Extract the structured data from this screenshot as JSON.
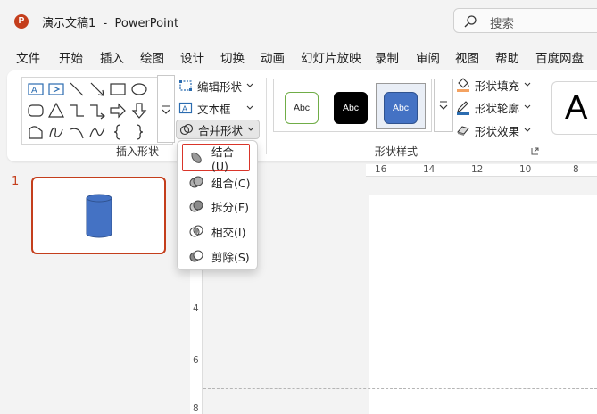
{
  "window": {
    "title": "演示文稿1  -  PowerPoint",
    "app_icon_letter": "P"
  },
  "search": {
    "placeholder": "搜索"
  },
  "menu": [
    "文件",
    "开始",
    "插入",
    "绘图",
    "设计",
    "切换",
    "动画",
    "幻灯片放映",
    "录制",
    "审阅",
    "视图",
    "帮助",
    "百度网盘"
  ],
  "ribbon": {
    "insert_shapes": {
      "label": "插入形状",
      "edit_shape": "编辑形状",
      "text_box": "文本框",
      "merge_shapes": "合并形状"
    },
    "shape_styles": {
      "label": "形状样式",
      "swatches": [
        {
          "text": "Abc",
          "fill": "#ffffff",
          "border": "#70ad47",
          "color": "#222222"
        },
        {
          "text": "Abc",
          "fill": "#000000",
          "border": "#000000",
          "color": "#ffffff"
        },
        {
          "text": "Abc",
          "fill": "#4472c4",
          "border": "#2f528f",
          "color": "#ffffff"
        }
      ],
      "fill": "形状填充",
      "outline": "形状轮廓",
      "effects": "形状效果"
    },
    "wordart_letter": "A"
  },
  "merge_menu": {
    "items": [
      {
        "label": "结合(U)",
        "name": "union"
      },
      {
        "label": "组合(C)",
        "name": "combine"
      },
      {
        "label": "拆分(F)",
        "name": "fragment"
      },
      {
        "label": "相交(I)",
        "name": "intersect"
      },
      {
        "label": "剪除(S)",
        "name": "subtract"
      }
    ]
  },
  "slides": {
    "current_number": "1"
  },
  "ruler": {
    "h_ticks": [
      "16",
      "14",
      "12",
      "10",
      "8"
    ],
    "v_ticks": [
      "4",
      "6",
      "8"
    ]
  },
  "colors": {
    "accent": "#c43e1c",
    "highlight": "#d9352a",
    "shape_fill": "#4472c4"
  }
}
